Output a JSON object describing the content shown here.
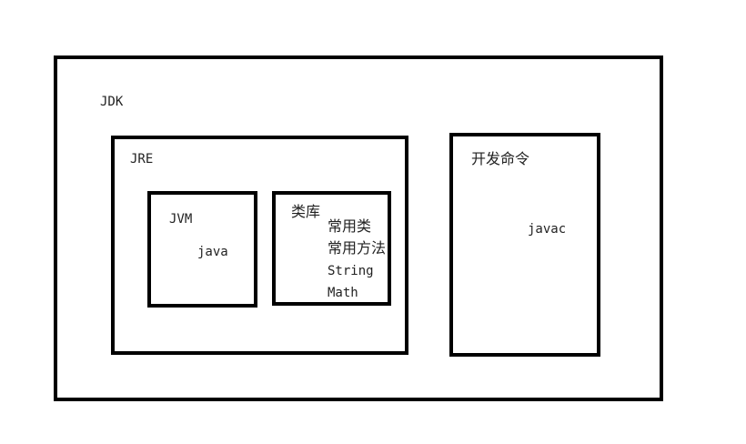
{
  "jdk": {
    "label": "JDK"
  },
  "jre": {
    "label": "JRE"
  },
  "jvm": {
    "label": "JVM",
    "command": "java"
  },
  "library": {
    "label": "类库",
    "items": [
      "常用类",
      "常用方法",
      "String",
      "Math"
    ]
  },
  "dev_commands": {
    "label": "开发命令",
    "command": "javac"
  },
  "colors": {
    "border": "#000000",
    "text": "#222222",
    "background": "#ffffff"
  }
}
